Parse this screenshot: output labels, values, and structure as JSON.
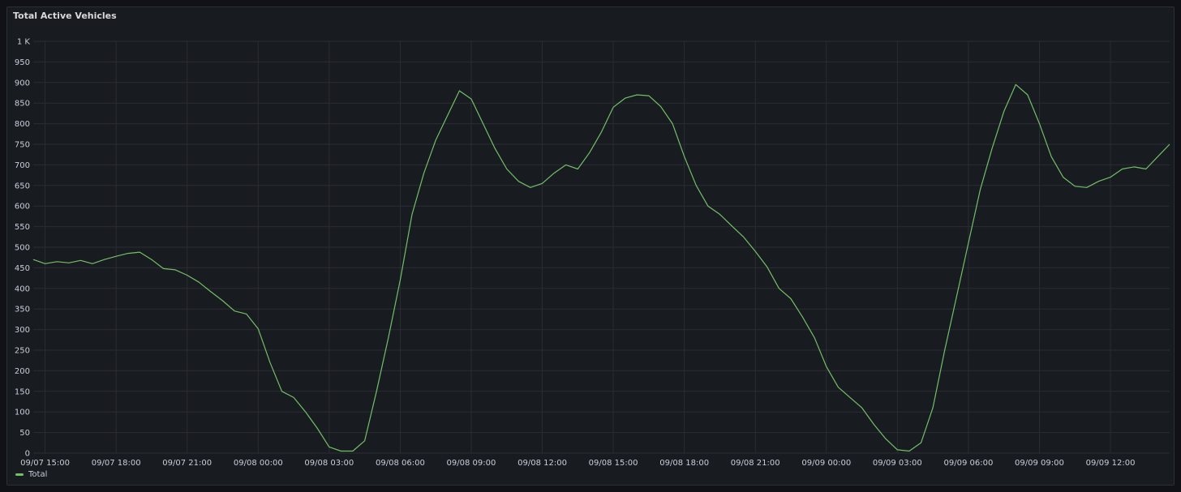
{
  "panel": {
    "title": "Total Active Vehicles"
  },
  "colors": {
    "series": "#73bf69",
    "grid": "#2a2d33",
    "text": "#ccccdc"
  },
  "chart_data": {
    "type": "line",
    "title": "Total Active Vehicles",
    "xlabel": "",
    "ylabel": "",
    "x_range": [
      "09/07 14:30",
      "09/09 14:30"
    ],
    "ylim": [
      0,
      1000
    ],
    "y_ticks": [
      {
        "value": 0,
        "label": "0"
      },
      {
        "value": 50,
        "label": "50"
      },
      {
        "value": 100,
        "label": "100"
      },
      {
        "value": 150,
        "label": "150"
      },
      {
        "value": 200,
        "label": "200"
      },
      {
        "value": 250,
        "label": "250"
      },
      {
        "value": 300,
        "label": "300"
      },
      {
        "value": 350,
        "label": "350"
      },
      {
        "value": 400,
        "label": "400"
      },
      {
        "value": 450,
        "label": "450"
      },
      {
        "value": 500,
        "label": "500"
      },
      {
        "value": 550,
        "label": "550"
      },
      {
        "value": 600,
        "label": "600"
      },
      {
        "value": 650,
        "label": "650"
      },
      {
        "value": 700,
        "label": "700"
      },
      {
        "value": 750,
        "label": "750"
      },
      {
        "value": 800,
        "label": "800"
      },
      {
        "value": 850,
        "label": "850"
      },
      {
        "value": 900,
        "label": "900"
      },
      {
        "value": 950,
        "label": "950"
      },
      {
        "value": 1000,
        "label": "1 K"
      }
    ],
    "x_ticks": [
      {
        "time": "09/07 15:00",
        "label": "09/07 15:00"
      },
      {
        "time": "09/07 18:00",
        "label": "09/07 18:00"
      },
      {
        "time": "09/07 21:00",
        "label": "09/07 21:00"
      },
      {
        "time": "09/08 00:00",
        "label": "09/08 00:00"
      },
      {
        "time": "09/08 03:00",
        "label": "09/08 03:00"
      },
      {
        "time": "09/08 06:00",
        "label": "09/08 06:00"
      },
      {
        "time": "09/08 09:00",
        "label": "09/08 09:00"
      },
      {
        "time": "09/08 12:00",
        "label": "09/08 12:00"
      },
      {
        "time": "09/08 15:00",
        "label": "09/08 15:00"
      },
      {
        "time": "09/08 18:00",
        "label": "09/08 18:00"
      },
      {
        "time": "09/08 21:00",
        "label": "09/08 21:00"
      },
      {
        "time": "09/09 00:00",
        "label": "09/09 00:00"
      },
      {
        "time": "09/09 03:00",
        "label": "09/09 03:00"
      },
      {
        "time": "09/09 06:00",
        "label": "09/09 06:00"
      },
      {
        "time": "09/09 09:00",
        "label": "09/09 09:00"
      },
      {
        "time": "09/09 12:00",
        "label": "09/09 12:00"
      }
    ],
    "series": [
      {
        "name": "Total",
        "color": "#73bf69",
        "points": [
          [
            "09/07 14:30",
            470
          ],
          [
            "09/07 15:00",
            460
          ],
          [
            "09/07 15:30",
            465
          ],
          [
            "09/07 16:00",
            462
          ],
          [
            "09/07 16:30",
            468
          ],
          [
            "09/07 17:00",
            460
          ],
          [
            "09/07 17:30",
            470
          ],
          [
            "09/07 18:00",
            478
          ],
          [
            "09/07 18:30",
            485
          ],
          [
            "09/07 19:00",
            488
          ],
          [
            "09/07 19:30",
            470
          ],
          [
            "09/07 20:00",
            448
          ],
          [
            "09/07 20:30",
            445
          ],
          [
            "09/07 21:00",
            432
          ],
          [
            "09/07 21:30",
            415
          ],
          [
            "09/07 22:00",
            392
          ],
          [
            "09/07 22:30",
            370
          ],
          [
            "09/07 23:00",
            345
          ],
          [
            "09/07 23:30",
            338
          ],
          [
            "09/08 00:00",
            302
          ],
          [
            "09/08 00:30",
            220
          ],
          [
            "09/08 01:00",
            150
          ],
          [
            "09/08 01:30",
            135
          ],
          [
            "09/08 02:00",
            100
          ],
          [
            "09/08 02:30",
            60
          ],
          [
            "09/08 03:00",
            15
          ],
          [
            "09/08 03:30",
            5
          ],
          [
            "09/08 04:00",
            5
          ],
          [
            "09/08 04:30",
            30
          ],
          [
            "09/08 05:00",
            150
          ],
          [
            "09/08 05:30",
            280
          ],
          [
            "09/08 06:00",
            420
          ],
          [
            "09/08 06:30",
            580
          ],
          [
            "09/08 07:00",
            680
          ],
          [
            "09/08 07:30",
            760
          ],
          [
            "09/08 08:00",
            820
          ],
          [
            "09/08 08:30",
            880
          ],
          [
            "09/08 09:00",
            860
          ],
          [
            "09/08 09:30",
            800
          ],
          [
            "09/08 10:00",
            740
          ],
          [
            "09/08 10:30",
            690
          ],
          [
            "09/08 11:00",
            660
          ],
          [
            "09/08 11:30",
            645
          ],
          [
            "09/08 12:00",
            655
          ],
          [
            "09/08 12:30",
            680
          ],
          [
            "09/08 13:00",
            700
          ],
          [
            "09/08 13:30",
            690
          ],
          [
            "09/08 14:00",
            730
          ],
          [
            "09/08 14:30",
            780
          ],
          [
            "09/08 15:00",
            840
          ],
          [
            "09/08 15:30",
            862
          ],
          [
            "09/08 16:00",
            870
          ],
          [
            "09/08 16:30",
            868
          ],
          [
            "09/08 17:00",
            842
          ],
          [
            "09/08 17:30",
            800
          ],
          [
            "09/08 18:00",
            720
          ],
          [
            "09/08 18:30",
            650
          ],
          [
            "09/08 19:00",
            600
          ],
          [
            "09/08 19:30",
            580
          ],
          [
            "09/08 20:00",
            552
          ],
          [
            "09/08 20:30",
            525
          ],
          [
            "09/08 21:00",
            490
          ],
          [
            "09/08 21:30",
            452
          ],
          [
            "09/08 22:00",
            400
          ],
          [
            "09/08 22:30",
            375
          ],
          [
            "09/08 23:00",
            330
          ],
          [
            "09/08 23:30",
            280
          ],
          [
            "09/09 00:00",
            210
          ],
          [
            "09/09 00:30",
            160
          ],
          [
            "09/09 01:00",
            135
          ],
          [
            "09/09 01:30",
            110
          ],
          [
            "09/09 02:00",
            70
          ],
          [
            "09/09 02:30",
            35
          ],
          [
            "09/09 03:00",
            8
          ],
          [
            "09/09 03:30",
            5
          ],
          [
            "09/09 04:00",
            25
          ],
          [
            "09/09 04:30",
            110
          ],
          [
            "09/09 05:00",
            250
          ],
          [
            "09/09 05:30",
            380
          ],
          [
            "09/09 06:00",
            510
          ],
          [
            "09/09 06:30",
            640
          ],
          [
            "09/09 07:00",
            740
          ],
          [
            "09/09 07:30",
            830
          ],
          [
            "09/09 08:00",
            895
          ],
          [
            "09/09 08:30",
            870
          ],
          [
            "09/09 09:00",
            800
          ],
          [
            "09/09 09:30",
            720
          ],
          [
            "09/09 10:00",
            670
          ],
          [
            "09/09 10:30",
            648
          ],
          [
            "09/09 11:00",
            645
          ],
          [
            "09/09 11:30",
            660
          ],
          [
            "09/09 12:00",
            670
          ],
          [
            "09/09 12:30",
            690
          ],
          [
            "09/09 13:00",
            695
          ],
          [
            "09/09 13:30",
            690
          ],
          [
            "09/09 14:00",
            720
          ],
          [
            "09/09 14:30",
            750
          ]
        ]
      }
    ],
    "grid": true,
    "legend": "bottom-left"
  }
}
